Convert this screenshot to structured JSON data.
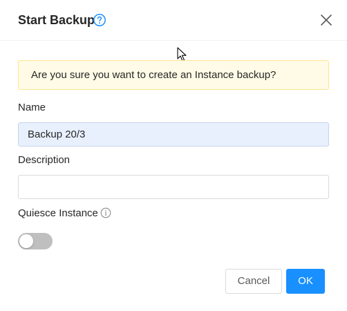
{
  "dialog": {
    "title": "Start Backup",
    "help_icon": "question-circle-icon",
    "close_icon": "close-icon"
  },
  "alert": {
    "message": "Are you sure you want to create an Instance backup?"
  },
  "form": {
    "name_label": "Name",
    "name_value": "Backup 20/3",
    "description_label": "Description",
    "description_value": "",
    "quiesce_label": "Quiesce Instance",
    "quiesce_info_icon": "info-circle-icon",
    "quiesce_enabled": false
  },
  "footer": {
    "cancel_label": "Cancel",
    "ok_label": "OK"
  },
  "colors": {
    "primary": "#1890ff",
    "alert_bg": "#fffbe6",
    "alert_border": "#ffe58f",
    "toggle_off": "#bfbfbf"
  }
}
